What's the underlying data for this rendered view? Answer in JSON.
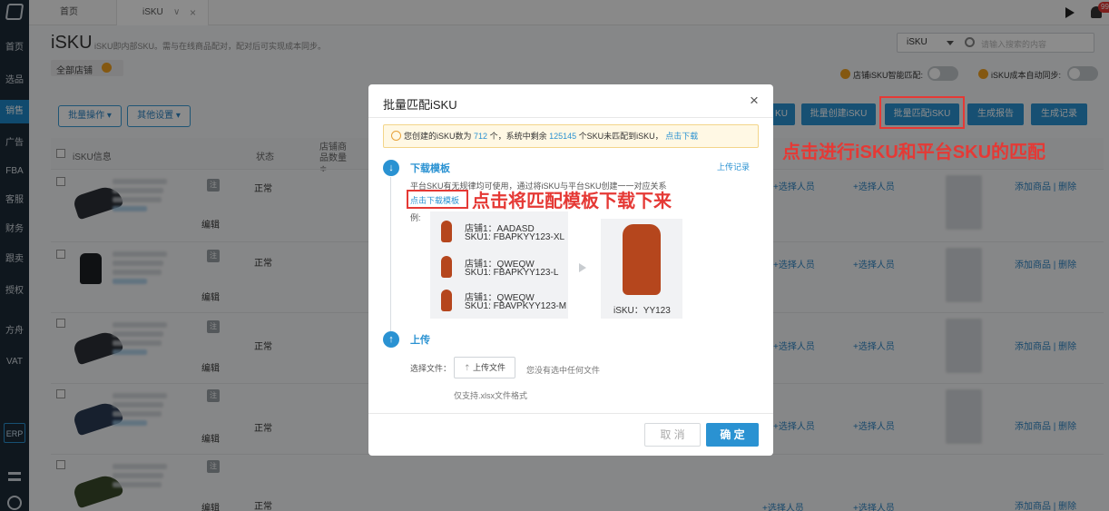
{
  "sidebar": {
    "items": [
      "首页",
      "选品",
      "销售",
      "广告",
      "FBA",
      "客服",
      "财务",
      "跟卖",
      "授权",
      "方舟",
      "VAT"
    ],
    "erp": "ERP"
  },
  "topbar": {
    "tabs": [
      "首页",
      "iSKU"
    ],
    "tab_arrow": "∨",
    "tab_close": "×",
    "badge": "99+"
  },
  "page": {
    "title": "iSKU",
    "desc": "iSKU即内部SKU。需与在线商品配对，配对后可实现成本同步。",
    "store_filter": "全部店铺",
    "search_select": "iSKU",
    "search_placeholder": "请输入搜索的内容",
    "toggle1_label": "店铺iSKU智能匹配:",
    "toggle2_label": "iSKU成本自动同步:",
    "btn_batch": "批量操作",
    "btn_other": "其他设置",
    "btn_k": "KU",
    "btn_create": "批量创建iSKU",
    "btn_match": "批量匹配iSKU",
    "btn_report": "生成报告",
    "btn_record": "生成记录"
  },
  "table": {
    "headers": {
      "info": "iSKU信息",
      "status": "状态",
      "count": "店铺商品数量 ≑"
    },
    "rows": [
      {
        "status": "正常",
        "assign1": "+选择人员",
        "assign2": "+选择人员",
        "actions": "添加商品 | 删除",
        "edit": "编辑"
      },
      {
        "status": "正常",
        "assign1": "+选择人员",
        "assign2": "+选择人员",
        "actions": "添加商品 | 删除",
        "edit": "编辑"
      },
      {
        "status": "正常",
        "assign1": "+选择人员",
        "assign2": "+选择人员",
        "actions": "添加商品 | 删除",
        "edit": "编辑"
      },
      {
        "status": "正常",
        "assign1": "+选择人员",
        "assign2": "+选择人员",
        "actions": "添加商品 | 删除",
        "edit": "编辑"
      },
      {
        "status": "正常",
        "assign1": "+选择人员",
        "assign2": "+选择人员",
        "actions": "添加商品 | 删除",
        "edit": "编辑"
      }
    ]
  },
  "modal": {
    "title": "批量匹配iSKU",
    "close": "×",
    "notice_pre": "您创建的iSKU数为",
    "notice_count1": "712",
    "notice_mid": "个，系统中剩余",
    "notice_count2": "125145",
    "notice_post": "个SKU未匹配到iSKU，",
    "notice_link": "点击下载",
    "step1_title": "下载模板",
    "upload_record": "上传记录",
    "step1_desc": "平台SKU有无规律均可使用，通过将iSKU与平台SKU创建一一对应关系",
    "download_link": "点击下载模板",
    "example_label": "例:",
    "examples": [
      {
        "store": "店铺1：AADASD",
        "sku": "SKU1: FBAPKYY123-XL"
      },
      {
        "store": "店铺1：QWEQW",
        "sku": "SKU1: FBAPKYY123-L"
      },
      {
        "store": "店铺1：QWEQW",
        "sku": "SKU1: FBAVPKYY123-M"
      }
    ],
    "result_label": "iSKU：YY123",
    "step2_title": "上传",
    "choose_label": "选择文件：",
    "upload_btn": "上传文件",
    "no_file": "您没有选中任何文件",
    "format_hint": "仅支持.xlsx文件格式",
    "cancel": "取 消",
    "confirm": "确 定"
  },
  "annotations": {
    "match_hint": "点击进行iSKU和平台SKU的匹配",
    "download_hint": "点击将匹配模板下载下来"
  },
  "colors": {
    "accent": "#2a92d2",
    "annotation": "#e53935",
    "sidebar": "#1d2a37"
  }
}
